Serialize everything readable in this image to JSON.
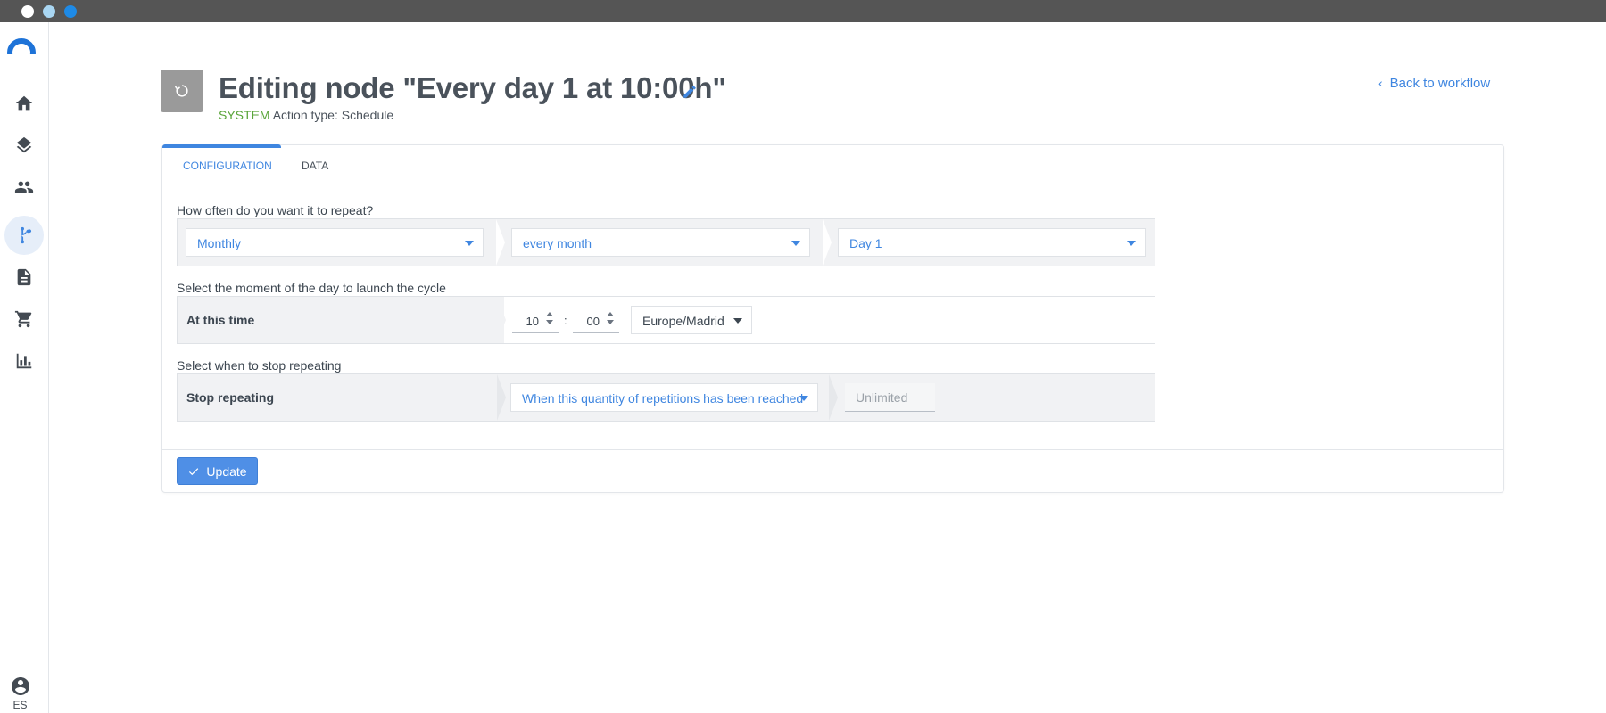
{
  "nav": {
    "items": [
      {
        "icon": "home-icon",
        "active": false
      },
      {
        "icon": "layers-icon",
        "active": false
      },
      {
        "icon": "people-icon",
        "active": false
      },
      {
        "icon": "workflow-icon",
        "active": true
      },
      {
        "icon": "document-icon",
        "active": false
      },
      {
        "icon": "cart-icon",
        "active": false
      },
      {
        "icon": "bar-chart-icon",
        "active": false
      }
    ],
    "language": "ES"
  },
  "header": {
    "title": "Editing node \"Every day 1 at 10:00h\"",
    "system_tag": "SYSTEM",
    "action_type": "Action type: Schedule",
    "back_link": "Back to workflow"
  },
  "tabs": [
    {
      "label": "CONFIGURATION",
      "active": true
    },
    {
      "label": "DATA",
      "active": false
    }
  ],
  "repeat": {
    "question": "How often do you want it to repeat?",
    "frequency": "Monthly",
    "interval": "every month",
    "day": "Day 1"
  },
  "launch": {
    "question": "Select the moment of the day to launch the cycle",
    "label": "At this time",
    "hour": "10",
    "separator": ":",
    "minute": "00",
    "timezone": "Europe/Madrid"
  },
  "stop": {
    "question": "Select when to stop repeating",
    "label": "Stop repeating",
    "condition": "When this quantity of repetitions has been reached",
    "limit_placeholder": "Unlimited"
  },
  "actions": {
    "update_label": "Update"
  },
  "colors": {
    "accent": "#3f86e0",
    "system_green": "#5aa53a",
    "chrome": "#555555"
  }
}
